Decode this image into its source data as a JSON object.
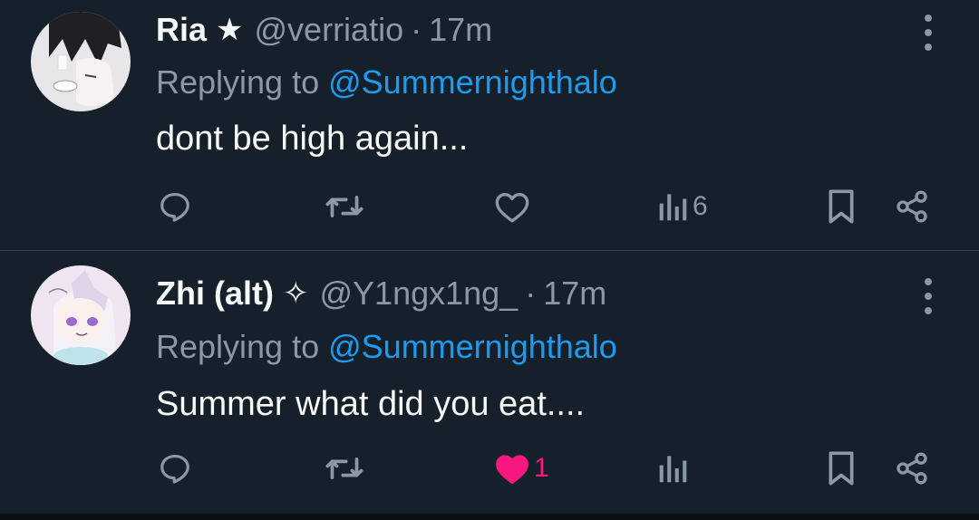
{
  "tweets": [
    {
      "name": "Ria",
      "badge": "★",
      "handle": "@verriatio",
      "separator": "·",
      "time": "17m",
      "replying_prefix": "Replying to ",
      "replying_to": "@Summernighthalo",
      "text": "dont be high again...",
      "actions": {
        "reply_count": "",
        "retweet_count": "",
        "like_count": "",
        "liked": false,
        "views_count": "6"
      }
    },
    {
      "name": "Zhi (alt)",
      "badge": "✧",
      "handle": "@Y1ngx1ng_",
      "separator": "·",
      "time": "17m",
      "replying_prefix": "Replying to ",
      "replying_to": "@Summernighthalo",
      "text": "Summer what did you eat....",
      "actions": {
        "reply_count": "",
        "retweet_count": "",
        "like_count": "1",
        "liked": true,
        "views_count": ""
      }
    }
  ],
  "colors": {
    "background": "#15202b",
    "text": "#f7f9f9",
    "muted": "#8b98a5",
    "link": "#1d9bf0",
    "like": "#f91880",
    "divider": "#38444d"
  },
  "icons": [
    "reply-icon",
    "retweet-icon",
    "like-icon",
    "views-icon",
    "bookmark-icon",
    "share-icon",
    "more-icon"
  ]
}
